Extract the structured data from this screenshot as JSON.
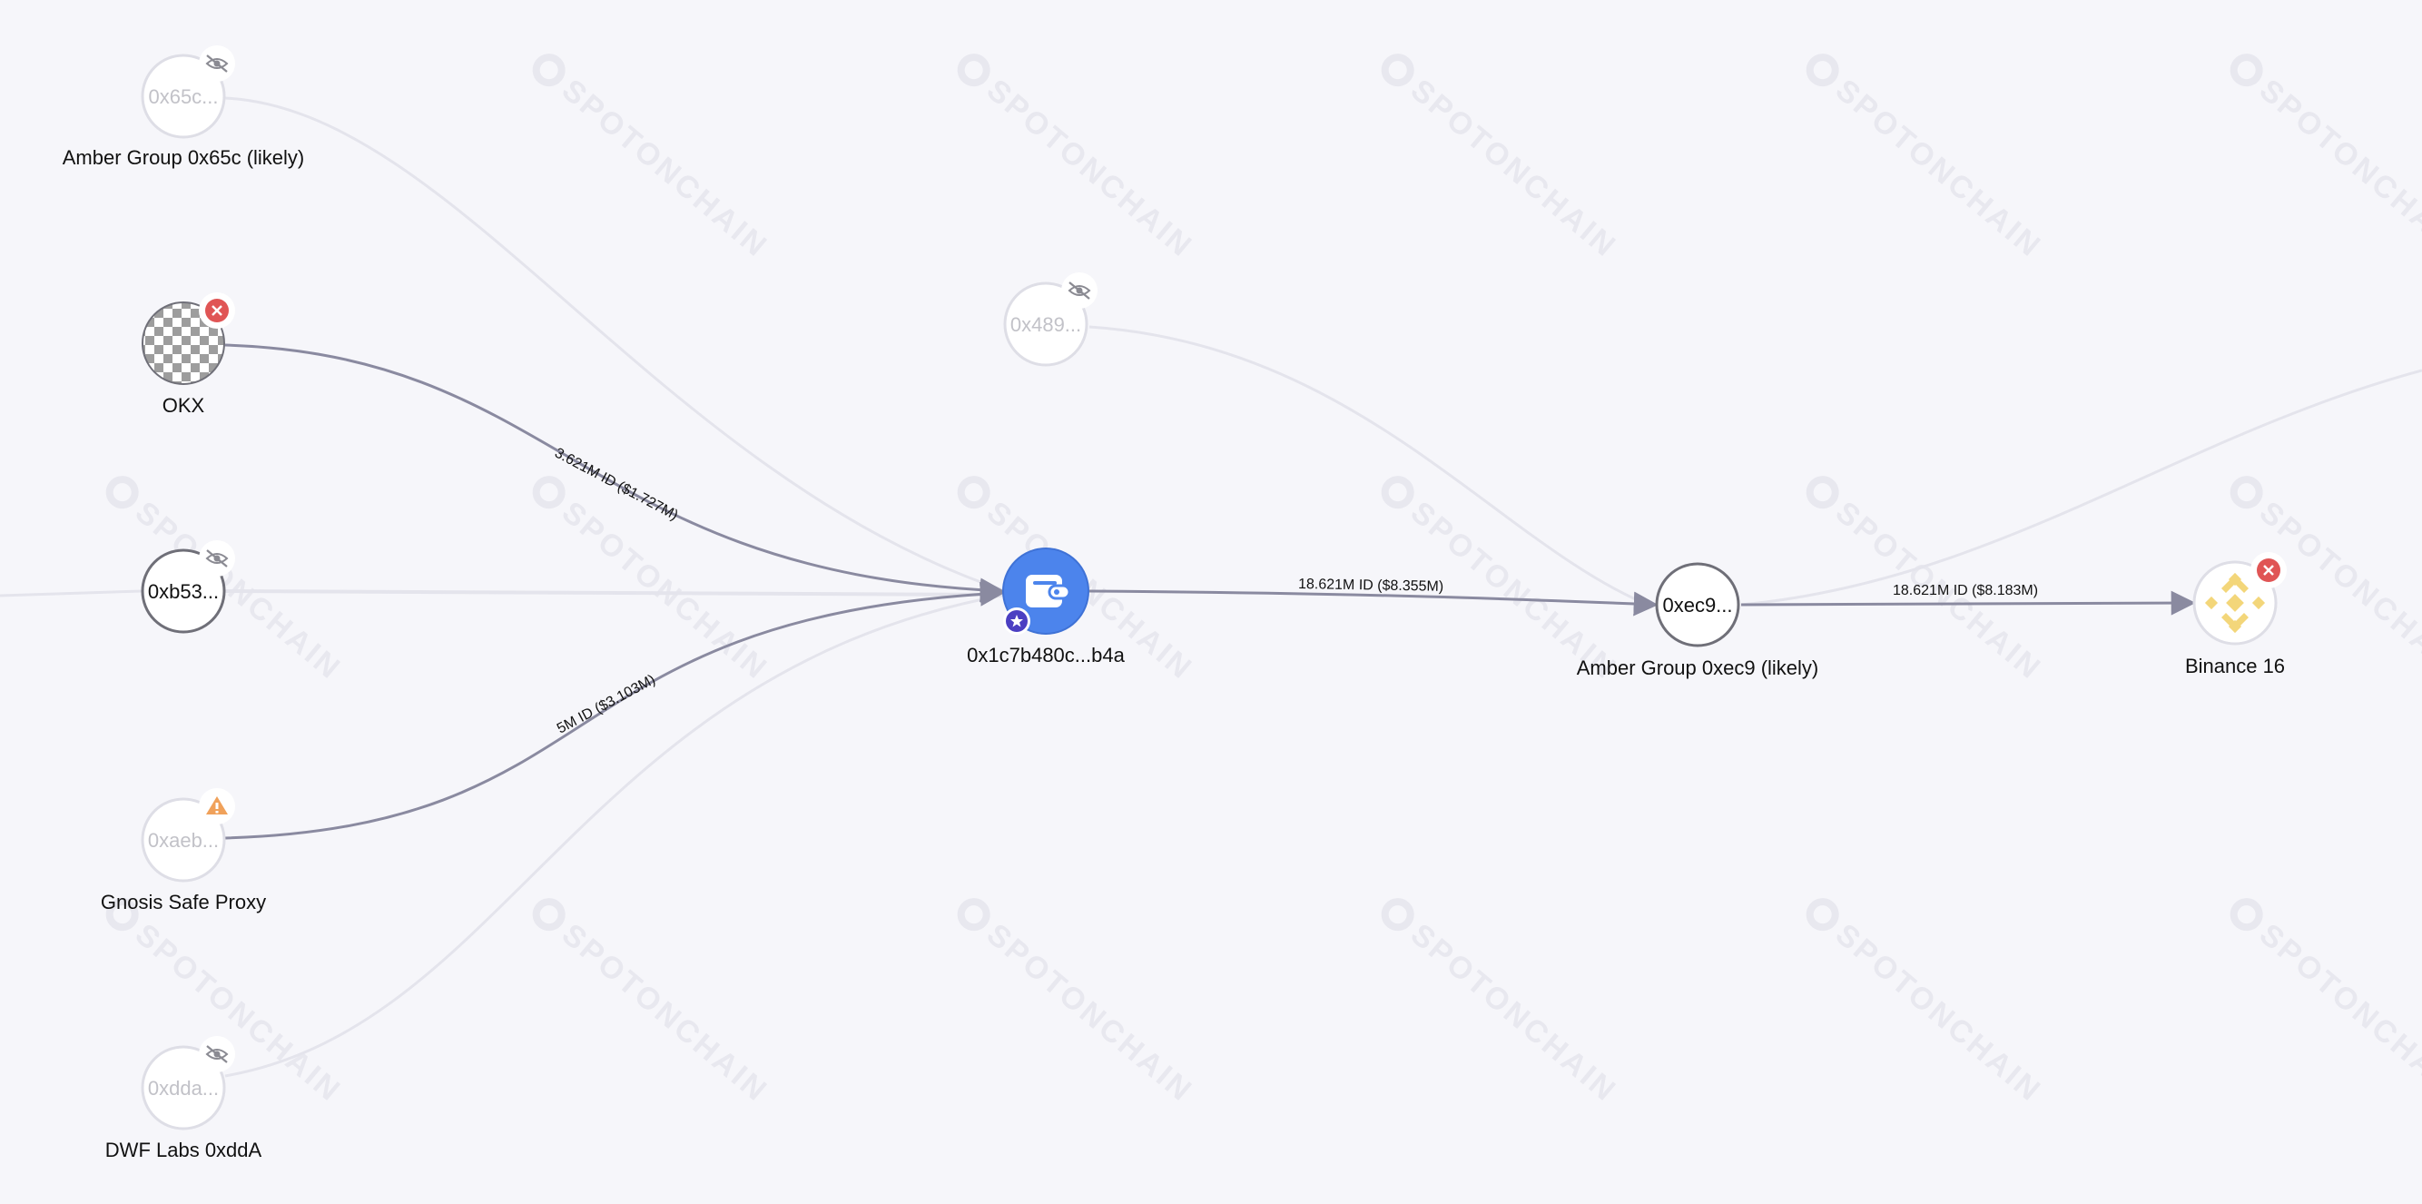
{
  "watermark": {
    "text": "SPOTONCHAIN"
  },
  "colors": {
    "background": "#f6f6fa",
    "active_edge": "#8a8aa0",
    "faded_edge": "#e4e4ec",
    "node_border": "#6f6f78",
    "faded_node_border": "#dedee6",
    "focus_node": "#4c84ec",
    "star_badge": "#4b3fc2",
    "alert_badge": "#e05555",
    "warning_badge": "#f0a15a",
    "binance_yellow": "#f3d67a"
  },
  "nodes": {
    "amber_0x65c": {
      "short": "0x65c...",
      "label": "Amber Group 0x65c (likely)",
      "badge_icon": "eye-slash-icon"
    },
    "okx": {
      "label": "OKX",
      "logo_icon": "okx-logo-icon",
      "badge_icon": "close-icon"
    },
    "wallet_0xb53": {
      "short": "0xb53...",
      "badge_icon": "eye-slash-icon"
    },
    "gnosis": {
      "short": "0xaeb...",
      "label": "Gnosis Safe Proxy",
      "badge_icon": "warning-icon"
    },
    "dwf": {
      "short": "0xdda...",
      "label": "DWF Labs 0xddA",
      "badge_icon": "eye-slash-icon"
    },
    "wallet_0x489": {
      "short": "0x489...",
      "badge_icon": "eye-slash-icon"
    },
    "focus": {
      "label": "0x1c7b480c...b4a",
      "logo_icon": "wallet-icon",
      "badge_icon": "star-icon"
    },
    "amber_0xec9": {
      "short": "0xec9...",
      "label": "Amber Group 0xec9 (likely)"
    },
    "binance16": {
      "label": "Binance 16",
      "logo_icon": "binance-logo-icon",
      "badge_icon": "close-icon"
    }
  },
  "edges": {
    "okx_to_focus": "3.621M ID ($1.727M)",
    "gnosis_to_focus": "5M ID ($3.103M)",
    "focus_to_amber": "18.621M ID ($8.355M)",
    "amber_to_binance": "18.621M ID ($8.183M)"
  }
}
